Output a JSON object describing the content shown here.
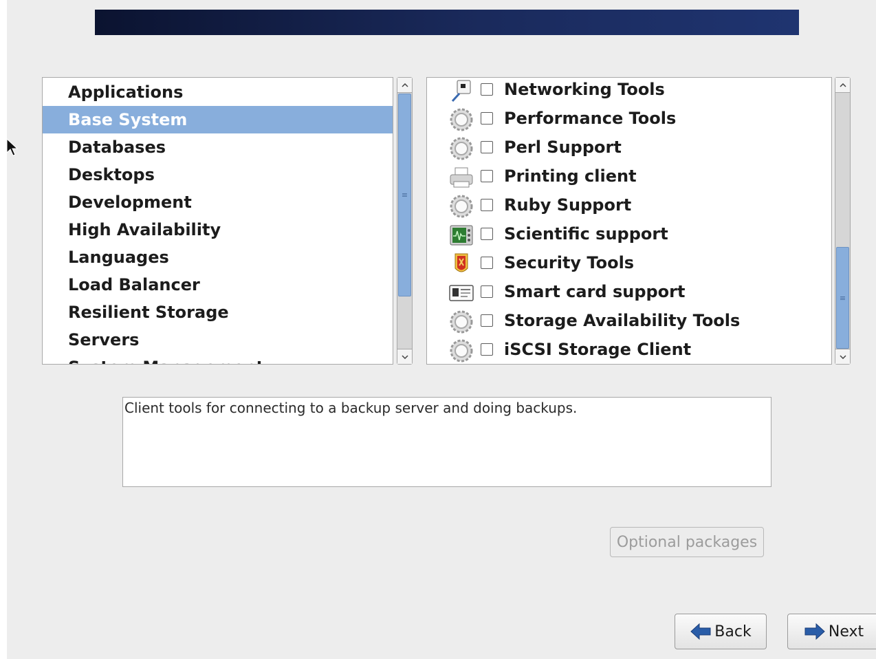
{
  "categories": {
    "items": [
      {
        "label": "Applications",
        "selected": false
      },
      {
        "label": "Base System",
        "selected": true
      },
      {
        "label": "Databases",
        "selected": false
      },
      {
        "label": "Desktops",
        "selected": false
      },
      {
        "label": "Development",
        "selected": false
      },
      {
        "label": "High Availability",
        "selected": false
      },
      {
        "label": "Languages",
        "selected": false
      },
      {
        "label": "Load Balancer",
        "selected": false
      },
      {
        "label": "Resilient Storage",
        "selected": false
      },
      {
        "label": "Servers",
        "selected": false
      },
      {
        "label": "System Management",
        "selected": false
      }
    ]
  },
  "groups": {
    "items": [
      {
        "label": "Networking Tools",
        "icon": "network-tools-icon",
        "checked": false
      },
      {
        "label": "Performance Tools",
        "icon": "gear-icon",
        "checked": false
      },
      {
        "label": "Perl Support",
        "icon": "gear-icon",
        "checked": false
      },
      {
        "label": "Printing client",
        "icon": "printer-icon",
        "checked": false
      },
      {
        "label": "Ruby Support",
        "icon": "gear-icon",
        "checked": false
      },
      {
        "label": "Scientific support",
        "icon": "oscilloscope-icon",
        "checked": false
      },
      {
        "label": "Security Tools",
        "icon": "shield-icon",
        "checked": false
      },
      {
        "label": "Smart card support",
        "icon": "id-card-icon",
        "checked": false
      },
      {
        "label": "Storage Availability Tools",
        "icon": "gear-icon",
        "checked": false
      },
      {
        "label": "iSCSI Storage Client",
        "icon": "gear-icon",
        "checked": false
      }
    ]
  },
  "description": {
    "text": "Client tools for connecting to a backup server and doing backups."
  },
  "buttons": {
    "optional_packages": "Optional packages",
    "back": "Back",
    "next": "Next"
  },
  "colors": {
    "selection": "#88aedc",
    "banner": "#0b1330",
    "arrow": "#2a5da8"
  }
}
